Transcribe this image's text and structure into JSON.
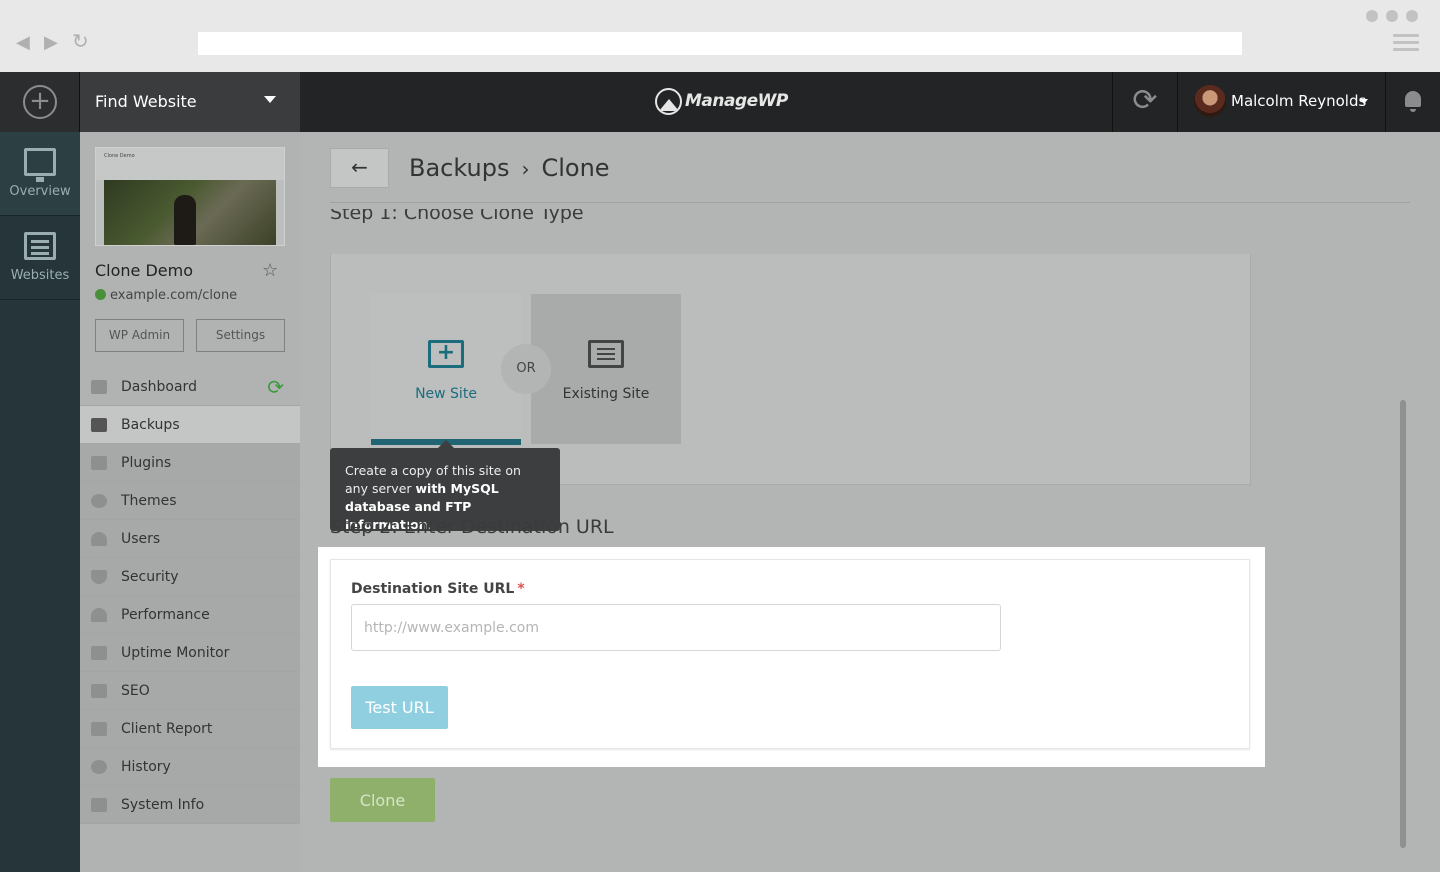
{
  "topbar": {
    "add_icon": "plus-circle-icon",
    "find_website": "Find Website",
    "brand": "ManageWP",
    "user_name": "Malcolm Reynolds"
  },
  "rail": {
    "items": [
      {
        "label": "Overview",
        "icon": "monitor-chart-icon"
      },
      {
        "label": "Websites",
        "icon": "list-icon"
      }
    ]
  },
  "site": {
    "thumbnail_title": "Clone Demo",
    "name": "Clone Demo",
    "url": "example.com/clone",
    "wp_admin": "WP Admin",
    "settings": "Settings"
  },
  "menu": {
    "items": [
      {
        "label": "Dashboard"
      },
      {
        "label": "Backups"
      },
      {
        "label": "Plugins"
      },
      {
        "label": "Themes"
      },
      {
        "label": "Users"
      },
      {
        "label": "Security"
      },
      {
        "label": "Performance"
      },
      {
        "label": "Uptime Monitor"
      },
      {
        "label": "SEO"
      },
      {
        "label": "Client Report"
      },
      {
        "label": "History"
      },
      {
        "label": "System Info"
      }
    ]
  },
  "main": {
    "back_label": "←",
    "breadcrumb": {
      "parent": "Backups",
      "separator": "›",
      "current": "Clone"
    },
    "step1_title": "Step 1: Choose Clone Type",
    "option_new": "New Site",
    "option_or": "OR",
    "option_existing": "Existing Site",
    "tooltip": {
      "part1": "Create a copy of this site on any server ",
      "bold": "with MySQL database and FTP information",
      "part2": "."
    },
    "step2_title": "Step 2: Enter Destination URL",
    "field_label": "Destination Site URL",
    "required_mark": "*",
    "url_placeholder": "http://www.example.com",
    "url_value": "",
    "test_url": "Test URL",
    "clone": "Clone"
  },
  "colors": {
    "accent_teal": "#1b6c7d",
    "test_button": "#8fcfe0",
    "clone_button": "#8eb06a",
    "status_green": "#4a8f3a"
  }
}
